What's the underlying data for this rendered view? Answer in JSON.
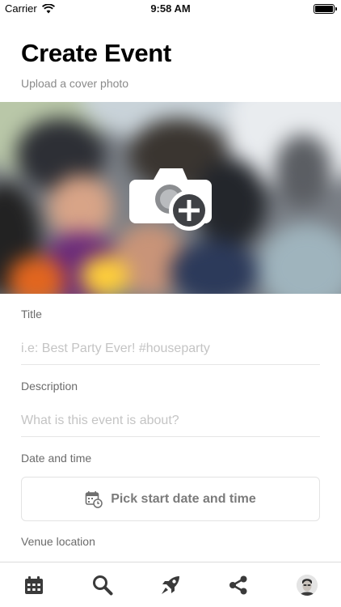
{
  "status_bar": {
    "carrier": "Carrier",
    "time": "9:58 AM"
  },
  "header": {
    "title": "Create Event",
    "subtitle": "Upload a cover photo"
  },
  "form": {
    "title_label": "Title",
    "title_placeholder": "i.e: Best Party Ever! #houseparty",
    "description_label": "Description",
    "description_placeholder": "What is this event is about?",
    "date_label": "Date and time",
    "date_button": "Pick start date and time",
    "venue_label": "Venue location"
  },
  "tab_bar": {
    "items": [
      {
        "icon": "calendar-icon"
      },
      {
        "icon": "search-icon"
      },
      {
        "icon": "rocket-icon"
      },
      {
        "icon": "share-icon"
      },
      {
        "icon": "avatar"
      }
    ]
  },
  "colors": {
    "icon": "#3a3a3a",
    "label": "#6b6b6b",
    "placeholder": "#c4c4c4"
  }
}
